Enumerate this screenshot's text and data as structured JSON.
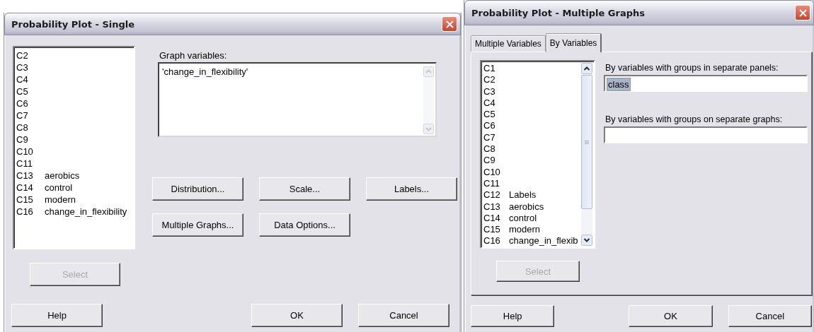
{
  "single_dialog": {
    "title": "Probability Plot - Single",
    "variables": [
      {
        "column": "C2"
      },
      {
        "column": "C3"
      },
      {
        "column": "C4"
      },
      {
        "column": "C5"
      },
      {
        "column": "C6"
      },
      {
        "column": "C7"
      },
      {
        "column": "C8"
      },
      {
        "column": "C9"
      },
      {
        "column": "C10"
      },
      {
        "column": "C11"
      },
      {
        "column": "C13",
        "name": "aerobics"
      },
      {
        "column": "C14",
        "name": "control"
      },
      {
        "column": "C15",
        "name": "modern"
      },
      {
        "column": "C16",
        "name": "change_in_flexibility"
      }
    ],
    "select_button": {
      "label": "Select",
      "disabled": true
    },
    "graph_variables": {
      "label": "Graph variables:",
      "value": "'change_in_flexibility'"
    },
    "option_buttons": [
      {
        "label": "Distribution...",
        "disabled": false
      },
      {
        "label": "Scale...",
        "disabled": false
      },
      {
        "label": "Labels...",
        "disabled": false
      },
      {
        "label": "Multiple Graphs...",
        "disabled": false
      },
      {
        "label": "Data Options...",
        "disabled": false
      }
    ],
    "footer_buttons": [
      {
        "label": "Help",
        "disabled": false
      },
      {
        "label": "OK",
        "disabled": false
      },
      {
        "label": "Cancel",
        "disabled": false
      }
    ]
  },
  "multiple_graphs_dialog": {
    "title": "Probability Plot - Multiple Graphs",
    "tabs": [
      {
        "label": "Multiple Variables",
        "selected": false
      },
      {
        "label": "By Variables",
        "selected": true
      }
    ],
    "variables": [
      {
        "column": "C1"
      },
      {
        "column": "C2"
      },
      {
        "column": "C3"
      },
      {
        "column": "C4"
      },
      {
        "column": "C5"
      },
      {
        "column": "C6"
      },
      {
        "column": "C7"
      },
      {
        "column": "C8"
      },
      {
        "column": "C9"
      },
      {
        "column": "C10"
      },
      {
        "column": "C11"
      },
      {
        "column": "C12",
        "name": "Labels"
      },
      {
        "column": "C13",
        "name": "aerobics"
      },
      {
        "column": "C14",
        "name": "control"
      },
      {
        "column": "C15",
        "name": "modern"
      },
      {
        "column": "C16",
        "name": "change_in_flexib"
      }
    ],
    "select_button": {
      "label": "Select",
      "disabled": true
    },
    "fields": [
      {
        "label": "By variables with groups in separate panels:",
        "value": "class",
        "value_selected": true
      },
      {
        "label": "By variables with groups on separate graphs:"
      }
    ],
    "footer_buttons": [
      {
        "label": "Help",
        "disabled": false
      },
      {
        "label": "OK",
        "disabled": false
      },
      {
        "label": "Cancel",
        "disabled": false
      }
    ]
  }
}
